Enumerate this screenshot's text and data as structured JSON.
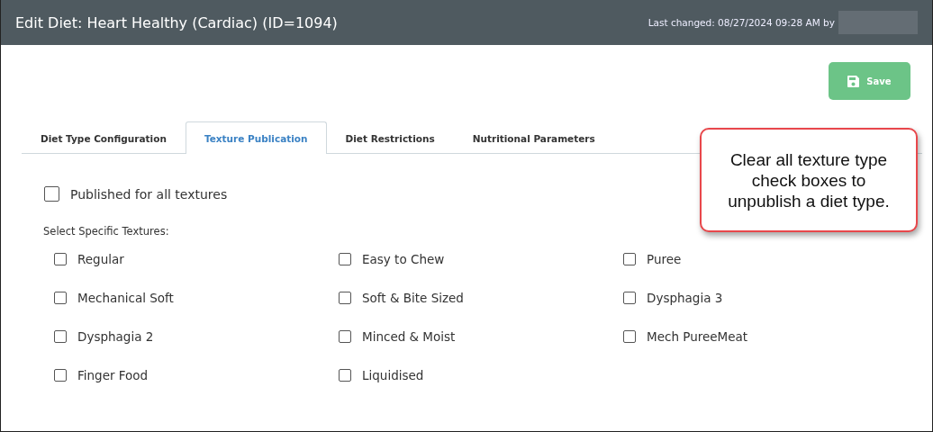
{
  "window": {
    "title": "Edit Diet: Heart Healthy (Cardiac) (ID=1094)",
    "last_changed": "Last changed: 08/27/2024 09:28 AM by"
  },
  "save_button": {
    "label": "Save"
  },
  "tabs": [
    {
      "label": "Diet Type Configuration",
      "selected": false
    },
    {
      "label": "Texture Publication",
      "selected": true
    },
    {
      "label": "Diet Restrictions",
      "selected": false
    },
    {
      "label": "Nutritional Parameters",
      "selected": false
    }
  ],
  "publish_all": {
    "label": "Published for all textures",
    "checked": false
  },
  "textures_label": "Select Specific Textures:",
  "textures": [
    {
      "label": "Regular",
      "checked": false
    },
    {
      "label": "Easy to Chew",
      "checked": false
    },
    {
      "label": "Puree",
      "checked": false
    },
    {
      "label": "Mechanical Soft",
      "checked": false
    },
    {
      "label": "Soft & Bite Sized",
      "checked": false
    },
    {
      "label": "Dysphagia 3",
      "checked": false
    },
    {
      "label": "Dysphagia 2",
      "checked": false
    },
    {
      "label": "Minced & Moist",
      "checked": false
    },
    {
      "label": "Mech PureeMeat",
      "checked": false
    },
    {
      "label": "Finger Food",
      "checked": false
    },
    {
      "label": "Liquidised",
      "checked": false
    }
  ],
  "callout": {
    "text": "Clear all texture type check boxes to unpublish a diet type."
  }
}
